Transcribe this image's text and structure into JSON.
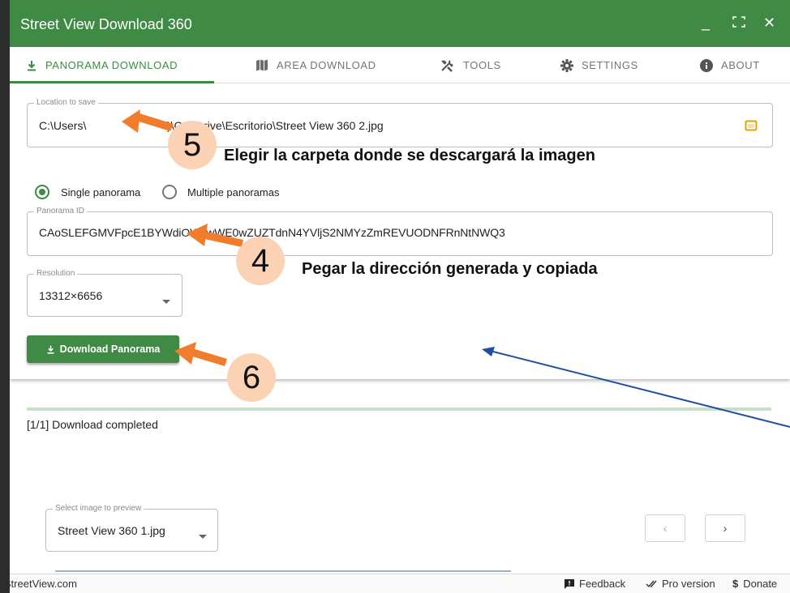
{
  "window": {
    "title": "Street View Download 360",
    "controls": {
      "minimize": "_",
      "maximize": "⛶",
      "close": "✕"
    }
  },
  "tabs": [
    {
      "label": "PANORAMA DOWNLOAD",
      "icon": "download-icon",
      "active": true
    },
    {
      "label": "AREA DOWNLOAD",
      "icon": "map-icon",
      "active": false
    },
    {
      "label": "TOOLS",
      "icon": "tools-icon",
      "active": false
    },
    {
      "label": "SETTINGS",
      "icon": "gear-icon",
      "active": false
    },
    {
      "label": "ABOUT",
      "icon": "info-icon",
      "active": false
    }
  ],
  "location": {
    "legend": "Location to save",
    "value_start": "C:\\Users\\",
    "value_end": ")\\OneDrive\\Escritorio\\Street View 360 2.jpg",
    "folder_icon": "folder-icon"
  },
  "mode": {
    "single": {
      "label": "Single panorama",
      "selected": true
    },
    "multiple": {
      "label": "Multiple panoramas",
      "selected": false
    }
  },
  "panorama_id": {
    "legend": "Panorama ID",
    "value": "CAoSLEFGMVFpcE1BYWdiOWcwWE0wZUZTdnN4YVljS2NMYzZmREVUODNFRnNtNWQ3"
  },
  "resolution": {
    "legend": "Resolution",
    "value": "13312×6656",
    "icon": "caret-down-icon"
  },
  "download_button": {
    "label": "Download Panorama",
    "icon": "download-icon"
  },
  "progress": {
    "fraction": 1.0
  },
  "status": "[1/1] Download completed",
  "preview": {
    "legend": "Select image to preview",
    "value": "Street View 360 1.jpg",
    "prev": "‹",
    "next": "›"
  },
  "footer": {
    "site": "iStreetView.com",
    "feedback": "Feedback",
    "pro": "Pro version",
    "donate": "Donate"
  },
  "annotations": {
    "step5": {
      "number": "5",
      "text": "Elegir la carpeta donde se descargará la imagen"
    },
    "step4": {
      "number": "4",
      "text": "Pegar la dirección generada y  copiada"
    },
    "step6": {
      "number": "6"
    }
  },
  "colors": {
    "primary_green": "#3f8a44",
    "arrow_orange": "#f07c2c",
    "badge_peach": "#fbd2b4",
    "pointer_blue": "#1f4fa0"
  }
}
